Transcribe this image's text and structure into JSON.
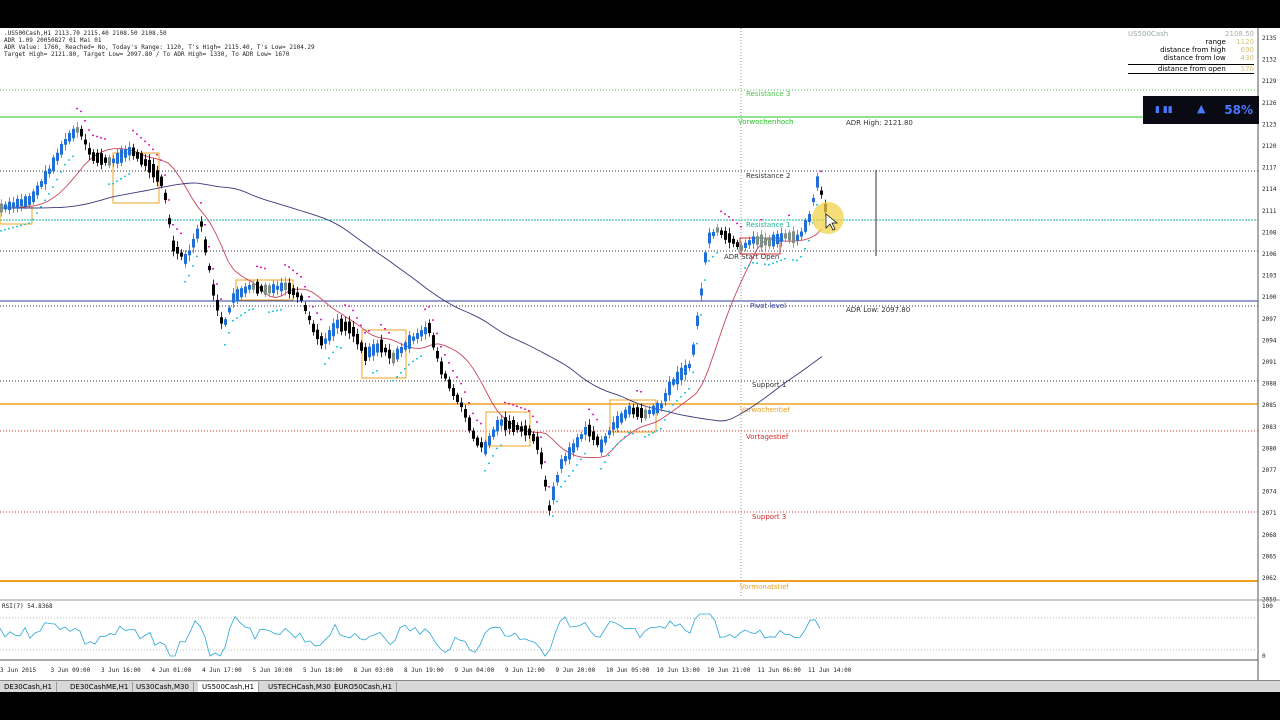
{
  "window": {
    "header_lines": [
      ".US500Cash,H1 2113.70 2115.40 2108.50 2108.50",
      "ADR 1.09 20050827 01 Mai 01",
      "ADR Value: 1760, Reached= No, Today's Range: 1120, T's High= 2115.40, T's Low= 2104.29",
      "Target High= 2121.80, Target Low= 2097.80 / To ADR High= 1330, To ADR Low= 1670"
    ]
  },
  "info_panel": {
    "symbol": "US500Cash",
    "price": "2108.50",
    "rows": [
      {
        "label": "range",
        "value": "1120"
      },
      {
        "label": "distance from high",
        "value": "690"
      },
      {
        "label": "distance from low",
        "value": "430"
      },
      {
        "label": "distance from open",
        "value": "170"
      }
    ]
  },
  "hud": {
    "percent": "58%"
  },
  "levels": {
    "resistance3": "Resistance 3",
    "vorwochenhoch": "Vorwochenhoch",
    "adr_high": "ADR High: 2121.80",
    "resistance2": "Resistance 2",
    "resistance1": "Resistance 1",
    "adr_start_open": "ADR Start Open",
    "pivot_level": "Pivot level",
    "adr_low": "ADR Low: 2097.80",
    "support1": "Support 1",
    "vorwochentief": "Vorwochentief",
    "vortagestief": "Vortagestief",
    "support3": "Support 3",
    "vormonatstief": "Vormonatstief"
  },
  "price_axis": [
    "2135",
    "2132",
    "2129",
    "2126",
    "2123",
    "2120",
    "2117",
    "2114",
    "2111",
    "2108",
    "2106",
    "2103",
    "2100",
    "2097",
    "2094",
    "2091",
    "2088",
    "2085",
    "2083",
    "2080",
    "2077",
    "2074",
    "2071",
    "2068",
    "2065",
    "2062",
    "2059"
  ],
  "rsi_label": "RSI(7) 54.8368",
  "rsi_axis": [
    "100",
    "0"
  ],
  "time_axis": [
    "3 Jun 2015",
    "3 Jun 09:00",
    "3 Jun 16:00",
    "4 Jun 01:00",
    "4 Jun 17:00",
    "5 Jun 10:00",
    "5 Jun 18:00",
    "8 Jun 03:00",
    "8 Jun 19:00",
    "9 Jun 04:00",
    "9 Jun 12:00",
    "9 Jun 20:00",
    "10 Jun 05:00",
    "10 Jun 13:00",
    "10 Jun 21:00",
    "11 Jun 06:00",
    "11 Jun 14:00"
  ],
  "tabs": [
    {
      "label": "DE30Cash,H1",
      "active": false
    },
    {
      "label": "DE30CashME,H1",
      "active": false
    },
    {
      "label": "US30Cash,M30",
      "active": false
    },
    {
      "label": "US500Cash,H1",
      "active": true
    },
    {
      "label": "USTECHCash,M30",
      "active": false
    },
    {
      "label": "EURO50Cash,H1",
      "active": false
    }
  ],
  "colors": {
    "bull": "#1f6fd6",
    "bear": "#000000",
    "neutral": "#7f8f86",
    "resistance": "#4ec34e",
    "support": "#d22d2d",
    "weekly": "#f0a020",
    "pivot": "#2d3fa0",
    "box": "#f0a020",
    "ma_fast": "#c8465a",
    "ma_slow": "#3a3a7a",
    "sar_down": "#e020c0",
    "sar_up": "#20c8e8"
  }
}
